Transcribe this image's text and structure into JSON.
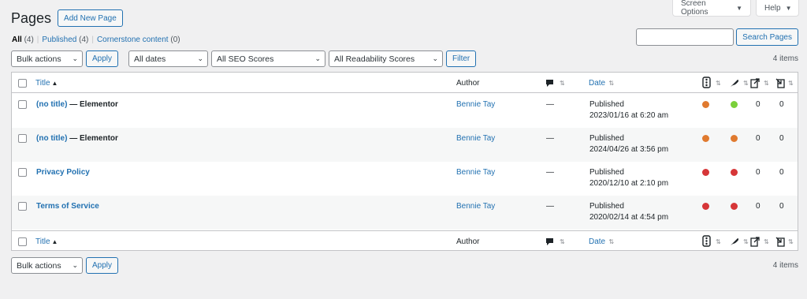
{
  "screen_meta": {
    "screen_options_label": "Screen Options",
    "help_label": "Help",
    "caret": "▼"
  },
  "heading": {
    "title": "Pages",
    "add_new_label": "Add New Page"
  },
  "views": {
    "all": {
      "label": "All",
      "count": "(4)"
    },
    "published": {
      "label": "Published",
      "count": "(4)"
    },
    "cornerstone": {
      "label": "Cornerstone content",
      "count": "(0)"
    },
    "separator": "|"
  },
  "search": {
    "placeholder": "",
    "button_label": "Search Pages"
  },
  "filters": {
    "bulk_actions": "Bulk actions",
    "apply_label": "Apply",
    "dates": "All dates",
    "seo_scores": "All SEO Scores",
    "readability_scores": "All Readability Scores",
    "filter_label": "Filter",
    "chevron": "⌄"
  },
  "items_count": "4 items",
  "table": {
    "columns": {
      "title": "Title",
      "author": "Author",
      "date": "Date",
      "comments_icon": "comment-bubble-icon",
      "seo_icon": "traffic-light-icon",
      "readability_icon": "feather-icon",
      "outgoing_links_icon": "outgoing-links-icon",
      "incoming_links_icon": "incoming-links-icon"
    },
    "rows": [
      {
        "title": "(no title)",
        "suffix": " — Elementor",
        "author": "Bennie Tay",
        "comments": "—",
        "status": "Published",
        "date": "2023/01/16 at 6:20 am",
        "seo": "#e07a2f",
        "readability": "#7ad03a",
        "outgoing": "0",
        "incoming": "0"
      },
      {
        "title": "(no title)",
        "suffix": " — Elementor",
        "author": "Bennie Tay",
        "comments": "—",
        "status": "Published",
        "date": "2024/04/26 at 3:56 pm",
        "seo": "#e07a2f",
        "readability": "#e07a2f",
        "outgoing": "0",
        "incoming": "0"
      },
      {
        "title": "Privacy Policy",
        "suffix": "",
        "author": "Bennie Tay",
        "comments": "—",
        "status": "Published",
        "date": "2020/12/10 at 2:10 pm",
        "seo": "#d63638",
        "readability": "#d63638",
        "outgoing": "0",
        "incoming": "0"
      },
      {
        "title": "Terms of Service",
        "suffix": "",
        "author": "Bennie Tay",
        "comments": "—",
        "status": "Published",
        "date": "2020/02/14 at 4:54 pm",
        "seo": "#d63638",
        "readability": "#d63638",
        "outgoing": "0",
        "incoming": "0"
      }
    ]
  },
  "colors": {
    "accent": "#2271b1",
    "background": "#f0f0f1",
    "border": "#c3c4c7"
  }
}
